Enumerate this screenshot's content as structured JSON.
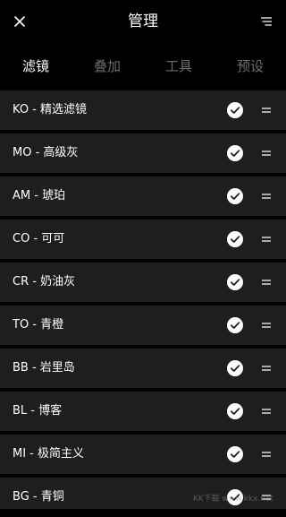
{
  "header": {
    "title": "管理",
    "close_icon": "close-icon",
    "sort_icon": "sort-list-icon"
  },
  "tabs": [
    {
      "label": "滤镜",
      "active": true
    },
    {
      "label": "叠加",
      "active": false
    },
    {
      "label": "工具",
      "active": false
    },
    {
      "label": "预设",
      "active": false
    }
  ],
  "items": [
    {
      "label": "KO - 精选滤镜",
      "checked": true
    },
    {
      "label": "MO - 高级灰",
      "checked": true
    },
    {
      "label": "AM - 琥珀",
      "checked": true
    },
    {
      "label": "CO - 可可",
      "checked": true
    },
    {
      "label": "CR - 奶油灰",
      "checked": true
    },
    {
      "label": "TO - 青橙",
      "checked": true
    },
    {
      "label": "BB - 岩里岛",
      "checked": true
    },
    {
      "label": "BL - 博客",
      "checked": true
    },
    {
      "label": "MI - 极简主义",
      "checked": true
    },
    {
      "label": "BG - 青铜",
      "checked": true
    }
  ],
  "colors": {
    "background": "#000000",
    "row_background": "#1e1e1e",
    "text": "#ffffff",
    "inactive_tab": "#6d6d6d"
  },
  "watermark": "KK下载 www.kkx.net"
}
